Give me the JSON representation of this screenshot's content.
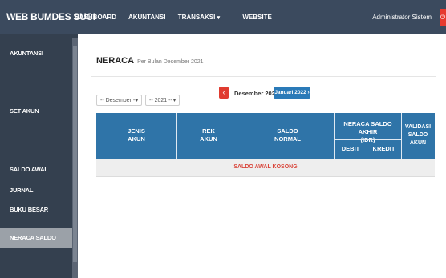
{
  "header": {
    "brand": "WEB BUMDES SUCI",
    "nav": [
      "DASHBOARD",
      "AKUNTANSI",
      "TRANSAKSI",
      "WEBSITE"
    ],
    "user": "Administrator Sistem"
  },
  "sidebar": {
    "items": [
      {
        "label": "AKUNTANSI",
        "style": "normal"
      },
      {
        "label": "",
        "style": "red"
      },
      {
        "label": "SET AKUN",
        "style": "normal"
      },
      {
        "label": "",
        "style": "red"
      },
      {
        "label": "SALDO AWAL",
        "style": "normal"
      },
      {
        "label": "JURNAL",
        "style": "normal"
      },
      {
        "label": "BUKU BESAR",
        "style": "normal"
      },
      {
        "label": "NERACA SALDO",
        "style": "active"
      },
      {
        "label": "",
        "style": "red"
      }
    ]
  },
  "page": {
    "title": "NERACA",
    "subtitle": "Per Bulan Desember 2021",
    "month_select": "-- Desember --",
    "year_select": "-- 2021 --",
    "prev_icon": "‹",
    "current_month": "Desember 2021",
    "next_label": "Januari 2022 ›"
  },
  "table": {
    "headers": {
      "jenis": "JENIS\nAKUN",
      "rek": "REK\nAKUN",
      "saldo": "SALDO\nNORMAL",
      "neraca": "NERACA SALDO AKHIR\n(IDR)",
      "debit": "DEBIT",
      "kredit": "KREDIT",
      "validasi": "VALIDASI\nSALDO\nAKUN"
    },
    "empty_message": "SALDO AWAL KOSONG"
  },
  "colors": {
    "topbar": "#3b4a5e",
    "sidebar": "#34404f",
    "table_header": "#2f74a8",
    "danger": "#e03b30",
    "primary": "#2a7ab8"
  }
}
